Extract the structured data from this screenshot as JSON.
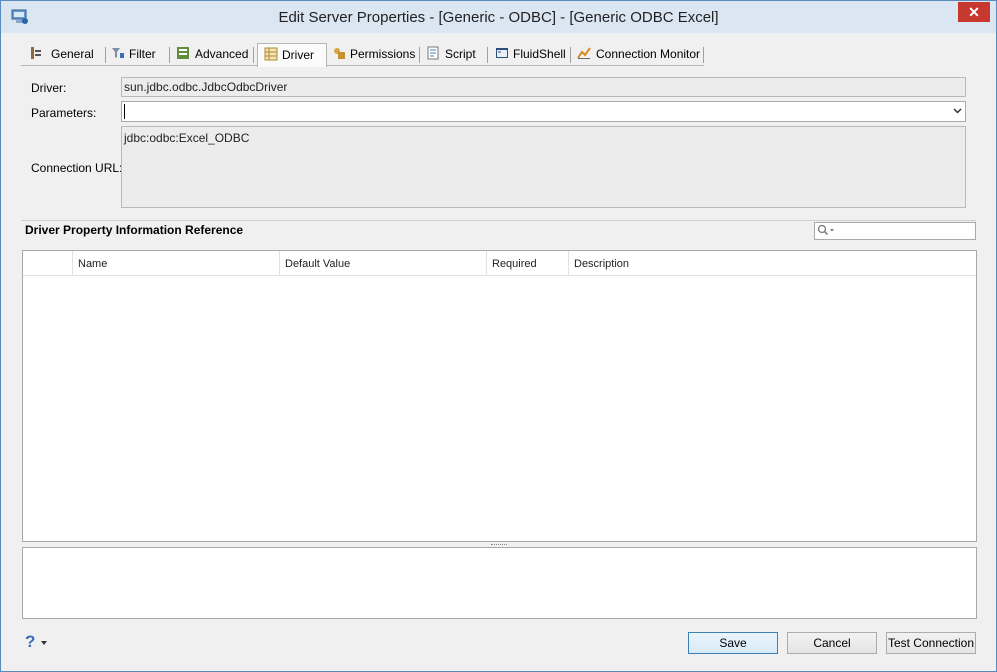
{
  "window": {
    "title": "Edit Server Properties - [Generic - ODBC] - [Generic ODBC Excel]",
    "close_glyph": "✕",
    "app_icon": "server-window-icon"
  },
  "tabs": [
    {
      "label": "General",
      "icon": "general-icon",
      "active": false
    },
    {
      "label": "Filter",
      "icon": "filter-icon",
      "active": false
    },
    {
      "label": "Advanced",
      "icon": "advanced-icon",
      "active": false
    },
    {
      "label": "Driver",
      "icon": "driver-icon",
      "active": true
    },
    {
      "label": "Permissions",
      "icon": "permissions-icon",
      "active": false
    },
    {
      "label": "Script",
      "icon": "script-icon",
      "active": false
    },
    {
      "label": "FluidShell",
      "icon": "fluidshell-icon",
      "active": false
    },
    {
      "label": "Connection Monitor",
      "icon": "connection-monitor-icon",
      "active": false
    }
  ],
  "driver": {
    "driver_label": "Driver:",
    "driver_value": "sun.jdbc.odbc.JdbcOdbcDriver",
    "parameters_label": "Parameters:",
    "parameters_value": "",
    "connection_url_label": "Connection URL:",
    "connection_url_value": "jdbc:odbc:Excel_ODBC"
  },
  "reference": {
    "title": "Driver Property Information Reference",
    "search_placeholder": "",
    "columns": [
      "",
      "Name",
      "Default Value",
      "Required",
      "Description"
    ],
    "rows": []
  },
  "footer": {
    "help_glyph": "?",
    "save_label": "Save",
    "cancel_label": "Cancel",
    "test_connection_label": "Test Connection"
  }
}
